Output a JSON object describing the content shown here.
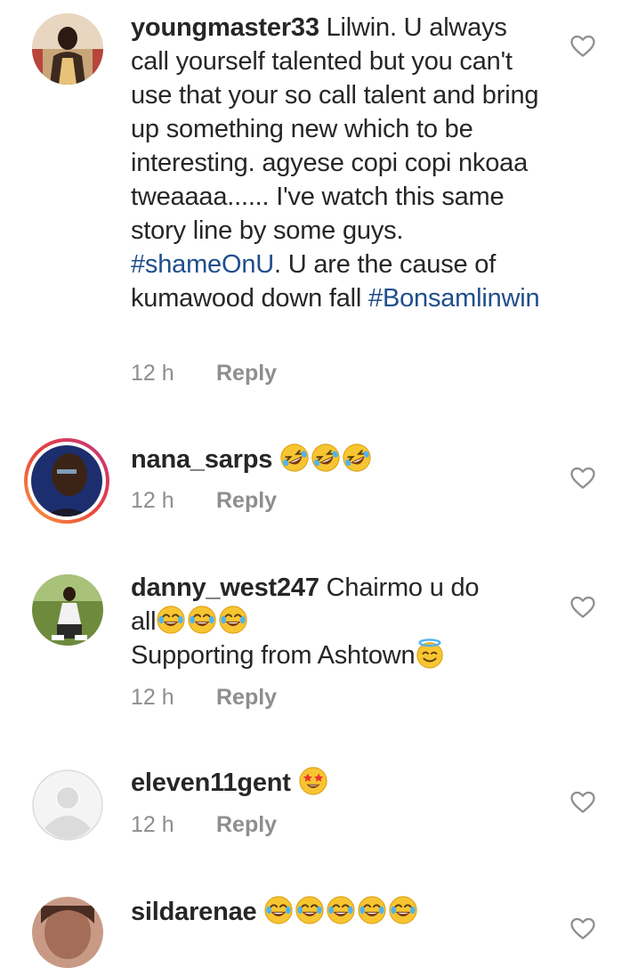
{
  "comments": [
    {
      "username": "youngmaster33",
      "text_parts": [
        " Lilwin. U always call yourself talented but you can't use that your so call talent and bring up something new which to be interesting. agyese copi copi nkoaa tweaaaa...... I've watch this same story line by some guys. ",
        "#shameOnU",
        ". U are the cause of kumawood down fall ",
        "#Bonsamlinwin"
      ],
      "time": "12 h",
      "reply": "Reply"
    },
    {
      "username": "nana_sarps",
      "emojis": [
        "rolling-laughing-emoji",
        "rolling-laughing-emoji",
        "rolling-laughing-emoji"
      ],
      "time": "12 h",
      "reply": "Reply"
    },
    {
      "username": "danny_west247",
      "line1": " Chairmo u do",
      "line2": "all",
      "line2_emojis": [
        "tears-of-joy-emoji",
        "tears-of-joy-emoji",
        "tears-of-joy-emoji"
      ],
      "line3": "Supporting from Ashtown",
      "line3_emoji": "halo-smile-emoji",
      "time": "12 h",
      "reply": "Reply"
    },
    {
      "username": "eleven11gent",
      "emojis": [
        "star-struck-emoji"
      ],
      "time": "12 h",
      "reply": "Reply"
    },
    {
      "username": "sildarenae",
      "emojis": [
        "tears-of-joy-emoji",
        "tears-of-joy-emoji",
        "tears-of-joy-emoji",
        "tears-of-joy-emoji",
        "tears-of-joy-emoji"
      ]
    }
  ],
  "colors": {
    "text": "#262626",
    "meta": "#8e8e8e",
    "hashtag": "#1f4e8c",
    "emoji_face": "#f7c531"
  }
}
